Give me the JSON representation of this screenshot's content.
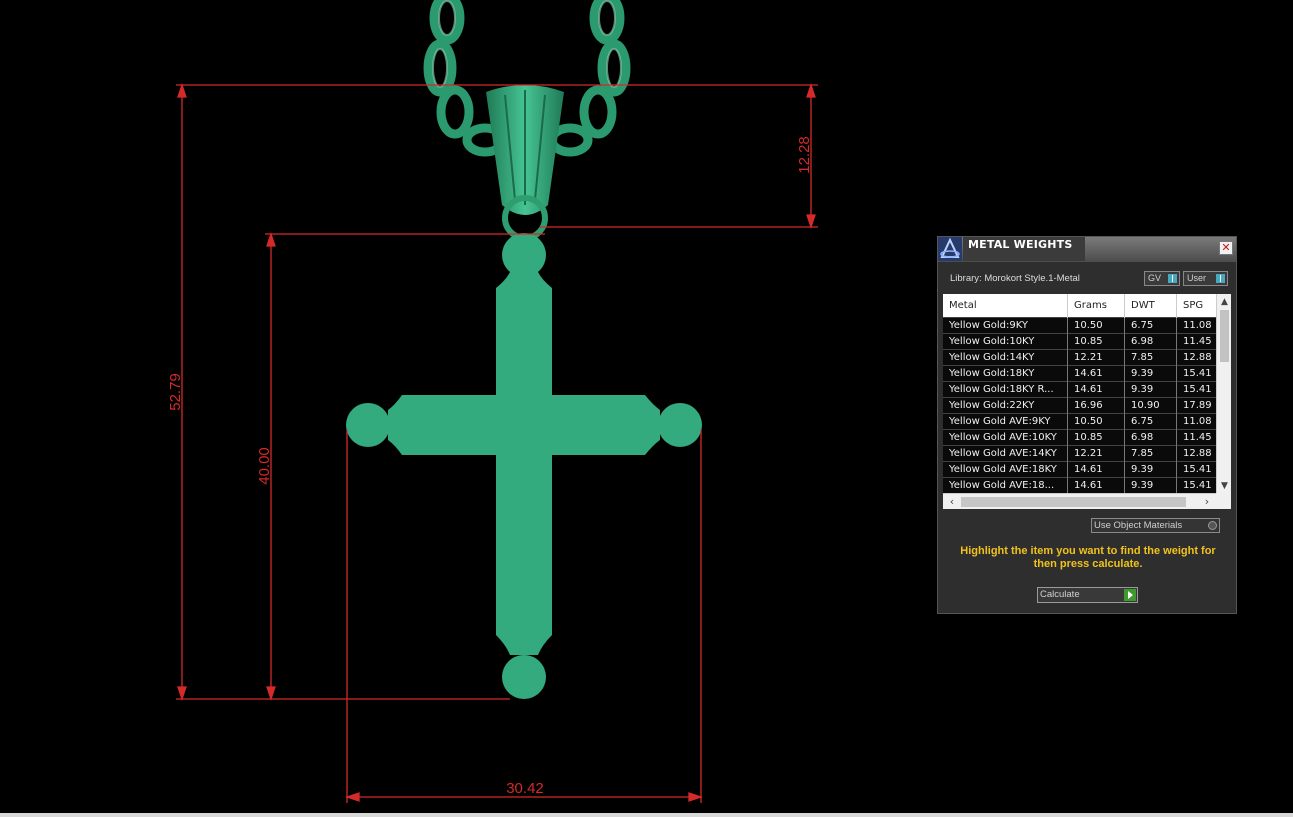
{
  "viewport": {
    "dimensions": {
      "total_height": "52.79",
      "cross_height": "40.00",
      "bail_height": "12.28",
      "cross_width": "30.42"
    },
    "colors": {
      "model": "#34ab7e",
      "dimension_lines": "#d42a2a",
      "background": "#000000"
    }
  },
  "panel": {
    "title": "METAL WEIGHTS",
    "logo_icon": "app-logo-icon",
    "close_icon": "close-icon",
    "library_label": "Library: Morokort Style.1-Metal",
    "unit_gv_label": "GV",
    "unit_user_label": "User",
    "table": {
      "headers": [
        "Metal",
        "Grams",
        "DWT",
        "SPG"
      ],
      "rows": [
        [
          "Yellow Gold:9KY",
          "10.50",
          "6.75",
          "11.08"
        ],
        [
          "Yellow Gold:10KY",
          "10.85",
          "6.98",
          "11.45"
        ],
        [
          "Yellow Gold:14KY",
          "12.21",
          "7.85",
          "12.88"
        ],
        [
          "Yellow Gold:18KY",
          "14.61",
          "9.39",
          "15.41"
        ],
        [
          "Yellow Gold:18KY R...",
          "14.61",
          "9.39",
          "15.41"
        ],
        [
          "Yellow Gold:22KY",
          "16.96",
          "10.90",
          "17.89"
        ],
        [
          "Yellow Gold AVE:9KY",
          "10.50",
          "6.75",
          "11.08"
        ],
        [
          "Yellow Gold AVE:10KY",
          "10.85",
          "6.98",
          "11.45"
        ],
        [
          "Yellow Gold AVE:14KY",
          "12.21",
          "7.85",
          "12.88"
        ],
        [
          "Yellow Gold AVE:18KY",
          "14.61",
          "9.39",
          "15.41"
        ],
        [
          "Yellow Gold AVE:18...",
          "14.61",
          "9.39",
          "15.41"
        ]
      ]
    },
    "use_object_materials_label": "Use Object Materials",
    "hint_text": "Highlight the item you want to find the weight for then press calculate.",
    "calculate_label": "Calculate",
    "colors": {
      "hint": "#f1c21b",
      "title_bar": "#5f5f5f",
      "calc_arrow": "#3e9a2e"
    }
  }
}
